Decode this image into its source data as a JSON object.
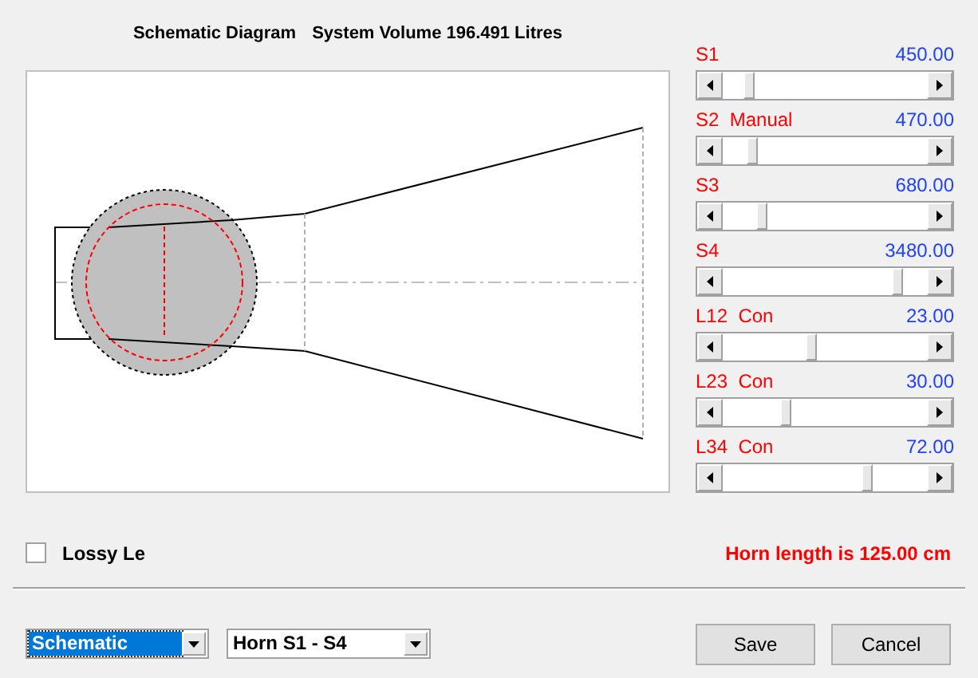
{
  "diagram": {
    "title": "Schematic Diagram",
    "volume": "System Volume 196.491 Litres"
  },
  "sliders": [
    {
      "label": "S1",
      "reading": "450.00",
      "level": 0.11
    },
    {
      "label": "S2  Manual",
      "reading": "470.00",
      "level": 0.12
    },
    {
      "label": "S3",
      "reading": "680.00",
      "level": 0.17
    },
    {
      "label": "S4",
      "reading": "3480.00",
      "level": 0.875
    },
    {
      "label": "L12  Con",
      "reading": "23.00",
      "level": 0.43
    },
    {
      "label": "L23  Con",
      "reading": "30.00",
      "level": 0.3
    },
    {
      "label": "L34  Con",
      "reading": "72.00",
      "level": 0.72
    }
  ],
  "lossy": {
    "label": "Lossy Le",
    "checked": false
  },
  "horn_length": "Horn length is 125.00 cm",
  "selects": [
    {
      "value": "Schematic",
      "focused": true
    },
    {
      "value": "Horn S1 - S4",
      "focused": false
    }
  ],
  "buttons": [
    {
      "label": "Save"
    },
    {
      "label": "Cancel"
    }
  ]
}
